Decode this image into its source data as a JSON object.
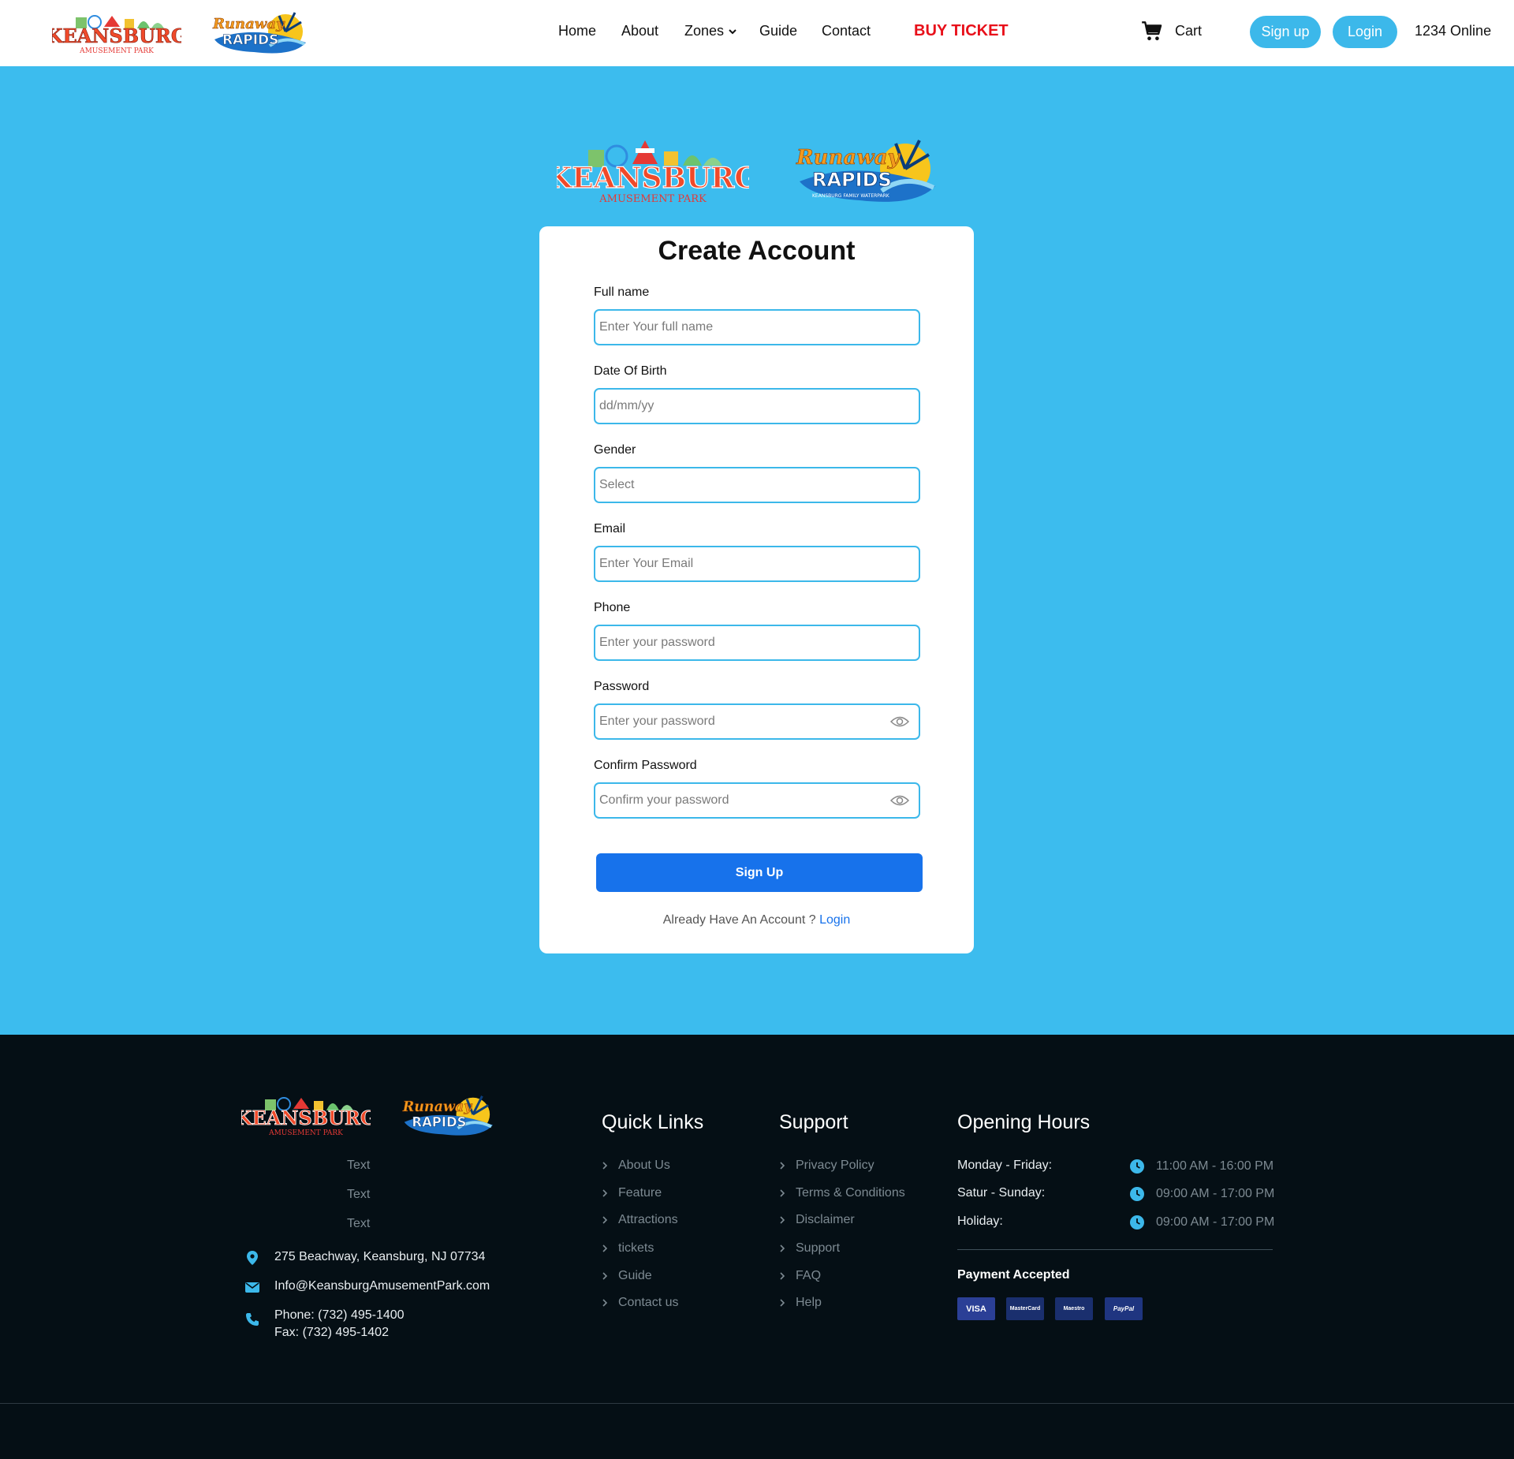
{
  "colors": {
    "accent": "#3cb8ea",
    "page_bg": "#3cbcee",
    "primary_button": "#1772eb",
    "buy_ticket": "#e8101a",
    "footer_bg": "#050f15"
  },
  "logos": {
    "keansburg": {
      "word": "KEANSBURG",
      "sub": "AMUSEMENT PARK"
    },
    "rapids": {
      "word1": "Runaway",
      "word2": "RAPIDS",
      "sub": "KEANSBURG FAMILY WATERPARK"
    }
  },
  "nav": {
    "items": [
      "Home",
      "About",
      "Zones",
      "Guide",
      "Contact"
    ],
    "zones_has_dropdown": true,
    "buy_ticket": "BUY TICKET",
    "cart": "Cart",
    "cart_icon": "cart-icon",
    "signup": "Sign up",
    "login": "Login",
    "online": "1234 Online"
  },
  "form": {
    "title": "Create Account",
    "fields": [
      {
        "label": "Full name",
        "placeholder": "Enter Your full name"
      },
      {
        "label": "Date Of Birth",
        "placeholder": "dd/mm/yy"
      },
      {
        "label": "Gender",
        "placeholder": "Select"
      },
      {
        "label": "Email",
        "placeholder": "Enter Your Email"
      },
      {
        "label": "Phone",
        "placeholder": "Enter your password"
      },
      {
        "label": "Password",
        "placeholder": "Enter your password",
        "icon": "eye-icon"
      },
      {
        "label": "Confirm Password",
        "placeholder": "Confirm your password",
        "icon": "eye-icon"
      }
    ],
    "submit": "Sign Up",
    "already_text": "Already Have An Account ?",
    "login_link": "Login"
  },
  "footer": {
    "placeholder_texts": [
      "Text",
      "Text",
      "Text"
    ],
    "address": "275 Beachway, Keansburg, NJ 07734",
    "email": "Info@KeansburgAmusementPark.com",
    "phone": "Phone: (732) 495-1400",
    "fax": "Fax: (732) 495-1402",
    "quick_links": {
      "title": "Quick Links",
      "items": [
        "About Us",
        "Feature",
        "Attractions",
        "tickets",
        "Guide",
        "Contact us"
      ]
    },
    "support": {
      "title": "Support",
      "items": [
        "Privacy Policy",
        "Terms & Conditions",
        "Disclaimer",
        "Support",
        "FAQ",
        "Help"
      ]
    },
    "hours": {
      "title": "Opening Hours",
      "rows": [
        {
          "day": "Monday - Friday:",
          "time": "11:00 AM - 16:00 PM"
        },
        {
          "day": "Satur - Sunday:",
          "time": "09:00 AM - 17:00 PM"
        },
        {
          "day": "Holiday:",
          "time": "09:00 AM - 17:00 PM"
        }
      ]
    },
    "payment": {
      "title": "Payment Accepted",
      "cards": [
        "VISA",
        "MasterCard",
        "Maestro",
        "PayPal"
      ]
    }
  }
}
